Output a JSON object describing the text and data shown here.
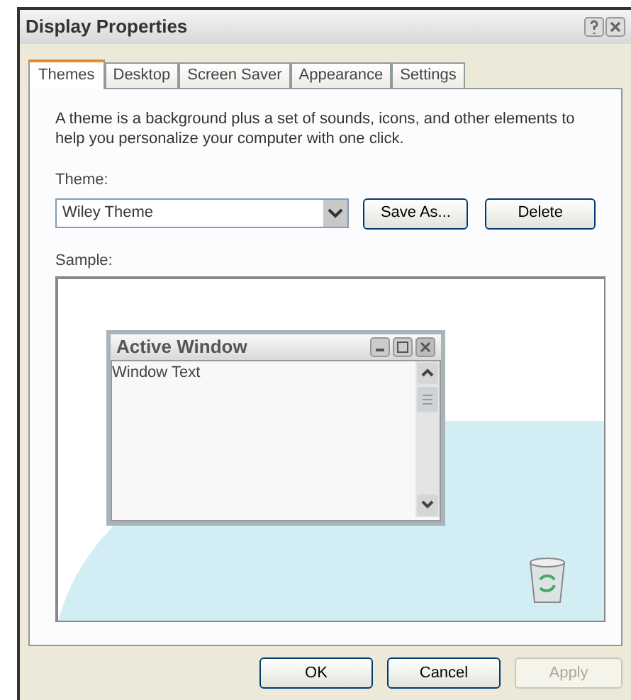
{
  "window": {
    "title": "Display Properties"
  },
  "tabs": [
    {
      "label": "Themes",
      "selected": true
    },
    {
      "label": "Desktop",
      "selected": false
    },
    {
      "label": "Screen Saver",
      "selected": false
    },
    {
      "label": "Appearance",
      "selected": false
    },
    {
      "label": "Settings",
      "selected": false
    }
  ],
  "description": "A theme is a background plus a set of sounds, icons, and other elements to help you personalize your computer with one click.",
  "theme": {
    "label": "Theme:",
    "value": "Wiley Theme",
    "buttons": [
      "Save As...",
      "Delete"
    ]
  },
  "sample": {
    "label": "Sample:",
    "window_title": "Active Window",
    "window_text": "Window Text"
  },
  "buttons": [
    {
      "label": "OK",
      "disabled": false
    },
    {
      "label": "Cancel",
      "disabled": false
    },
    {
      "label": "Apply",
      "disabled": true
    }
  ]
}
